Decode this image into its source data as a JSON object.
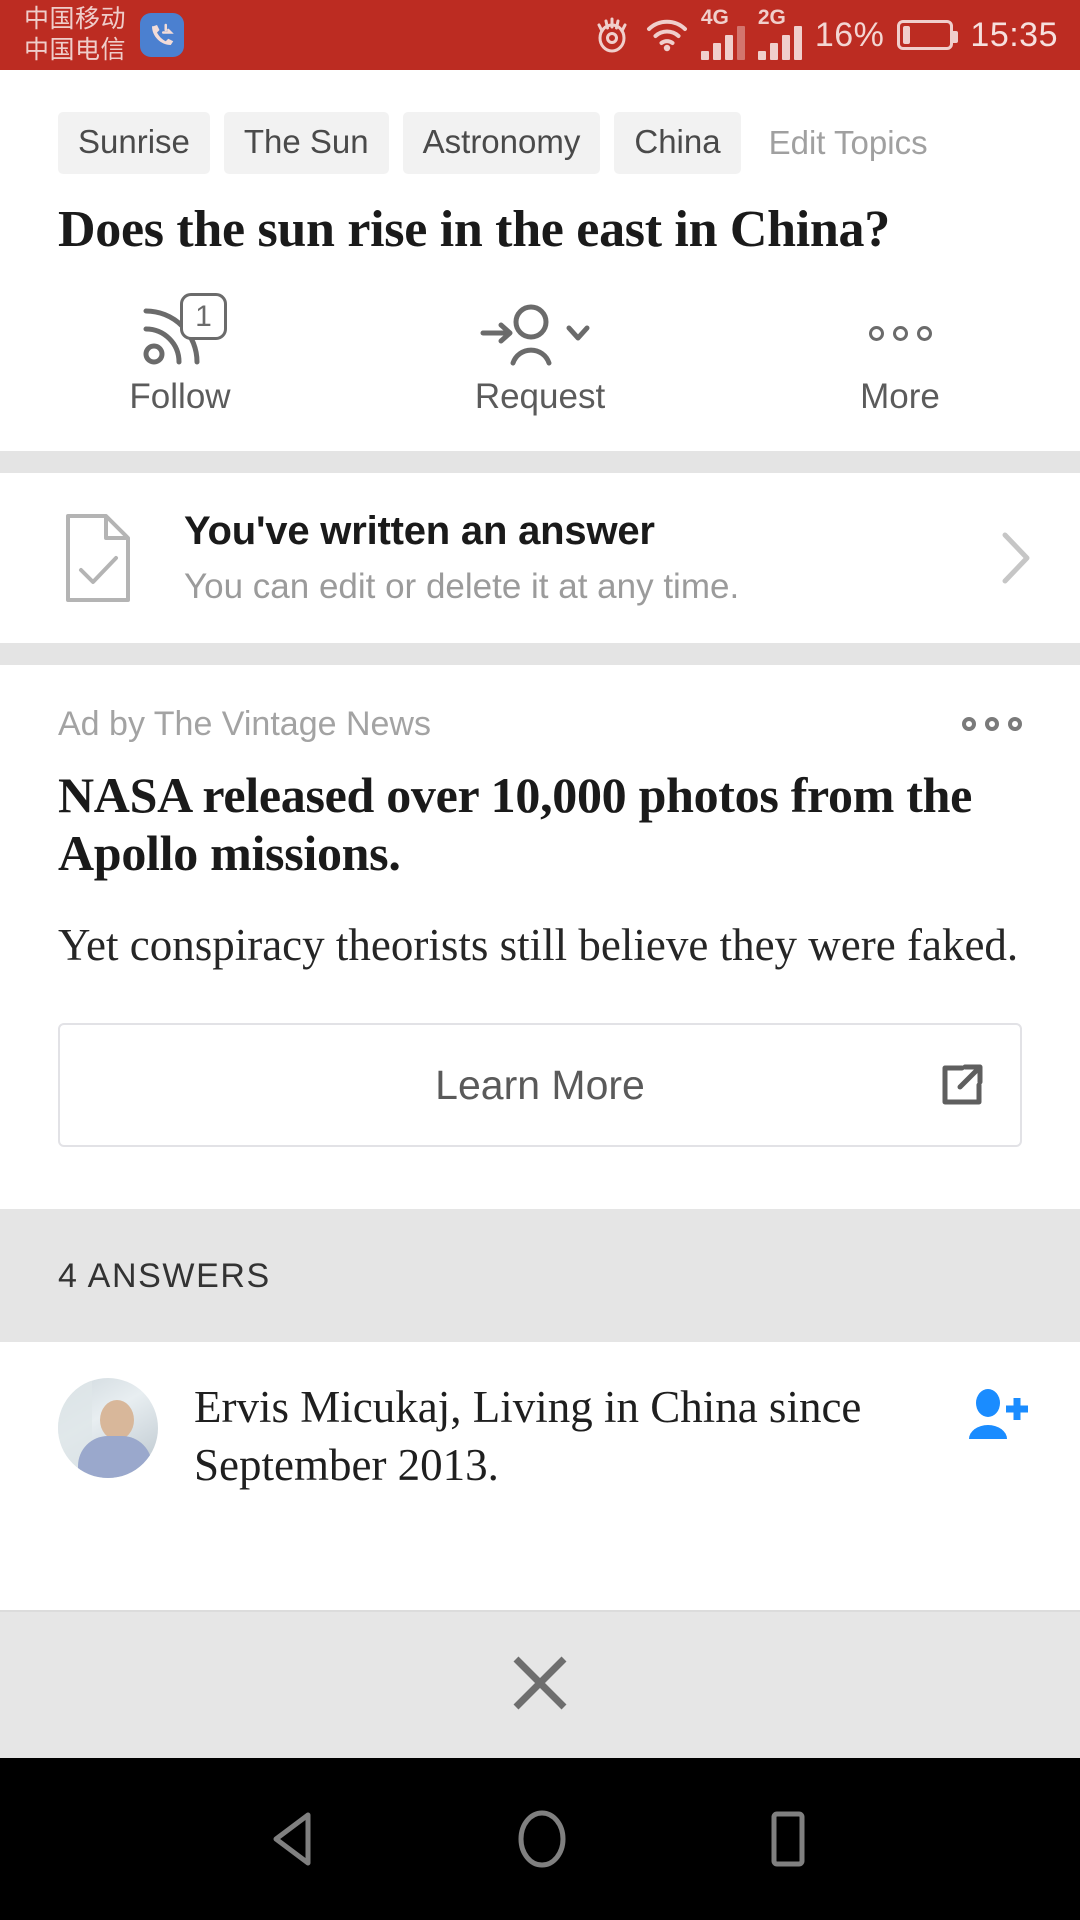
{
  "status_bar": {
    "carrier_line1": "中国移动",
    "carrier_line2": "中国电信",
    "call_icon": "missed-call-icon",
    "eye_icon": "eye-comfort-icon",
    "wifi_icon": "wifi-icon",
    "net1_label": "4G",
    "net2_label": "2G",
    "battery_percent": "16%",
    "battery_level": 16,
    "time": "15:35",
    "background_color": "#bc2c22",
    "foreground_color": "#f0cfcc"
  },
  "topics": {
    "chips": [
      "Sunrise",
      "The Sun",
      "Astronomy",
      "China"
    ],
    "edit_label": "Edit Topics"
  },
  "question": {
    "title": "Does the sun rise in the east in China?"
  },
  "actions": [
    {
      "label": "Follow",
      "icon": "follow-rss-icon",
      "badge": "1"
    },
    {
      "label": "Request",
      "icon": "request-person-icon",
      "chevron": "chevron-down-icon"
    },
    {
      "label": "More",
      "icon": "more-dots-icon"
    }
  ],
  "written_answer": {
    "icon": "document-check-icon",
    "title": "You've written an answer",
    "subtitle": "You can edit or delete it at any time.",
    "chevron": "chevron-right-icon"
  },
  "ad": {
    "sponsor": "Ad by The Vintage News",
    "menu_icon": "more-dots-icon",
    "title": "NASA released over 10,000 photos from the Apollo missions.",
    "body": "Yet conspiracy theorists still believe they were faked.",
    "cta_label": "Learn More",
    "cta_icon": "external-link-icon"
  },
  "answers_section": {
    "header": "4 ANSWERS",
    "count": 4,
    "header_bg": "#e5e5e5"
  },
  "answer": {
    "avatar": "user-avatar",
    "byline": "Ervis Micukaj, Living in China since September 2013.",
    "follow_icon": "add-user-icon",
    "follow_icon_color": "#1a8cff"
  },
  "bottom_bar": {
    "close_icon": "close-x-icon",
    "background_color": "#e6e6e6"
  },
  "nav_bar": {
    "back_icon": "back-triangle-icon",
    "home_icon": "home-circle-icon",
    "recents_icon": "recents-square-icon",
    "background_color": "#000000"
  }
}
